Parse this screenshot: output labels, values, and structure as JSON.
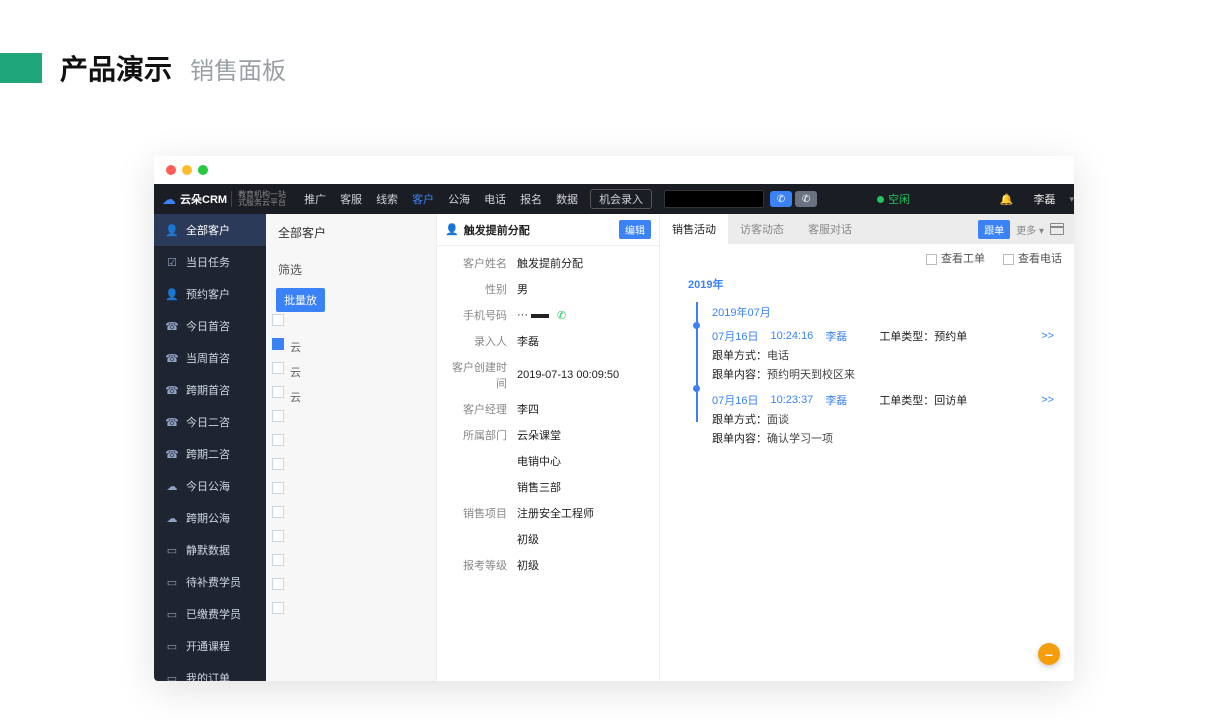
{
  "page": {
    "title": "产品演示",
    "subtitle": "销售面板"
  },
  "topnav": {
    "brand": "云朵CRM",
    "brand_sub1": "教育机构一站",
    "brand_sub2": "式服务云平台",
    "items": [
      "推广",
      "客服",
      "线索",
      "客户",
      "公海",
      "电话",
      "报名",
      "数据"
    ],
    "active_index": 3,
    "opportunity_btn": "机会录入",
    "status_text": "空闲",
    "username": "李磊"
  },
  "sidebar": {
    "items": [
      {
        "icon": "👤",
        "label": "全部客户",
        "active": true
      },
      {
        "icon": "☑",
        "label": "当日任务"
      },
      {
        "icon": "👤",
        "label": "预约客户"
      },
      {
        "icon": "☎",
        "label": "今日首咨"
      },
      {
        "icon": "☎",
        "label": "当周首咨"
      },
      {
        "icon": "☎",
        "label": "跨期首咨"
      },
      {
        "icon": "☎",
        "label": "今日二咨"
      },
      {
        "icon": "☎",
        "label": "跨期二咨"
      },
      {
        "icon": "☁",
        "label": "今日公海"
      },
      {
        "icon": "☁",
        "label": "跨期公海"
      },
      {
        "icon": "▭",
        "label": "静默数据"
      },
      {
        "icon": "▭",
        "label": "待补费学员"
      },
      {
        "icon": "▭",
        "label": "已缴费学员"
      },
      {
        "icon": "▭",
        "label": "开通课程"
      },
      {
        "icon": "▭",
        "label": "我的订单"
      }
    ]
  },
  "list": {
    "header": "全部客户",
    "filter_label": "筛选",
    "batch_btn": "批量放",
    "rows": [
      "云",
      "云",
      "云"
    ]
  },
  "detail": {
    "title": "触发提前分配",
    "edit": "编辑",
    "fields": [
      {
        "label": "客户姓名",
        "value": "触发提前分配"
      },
      {
        "label": "性别",
        "value": "男"
      },
      {
        "label": "手机号码",
        "value": "",
        "phone": true
      },
      {
        "label": "录入人",
        "value": "李磊"
      },
      {
        "label": "客户创建时间",
        "value": "2019-07-13 00:09:50"
      },
      {
        "label": "客户经理",
        "value": "李四"
      },
      {
        "label": "所属部门",
        "value": "云朵课堂"
      },
      {
        "label": "",
        "value": "电销中心"
      },
      {
        "label": "",
        "value": "销售三部"
      },
      {
        "label": "销售项目",
        "value": "注册安全工程师"
      },
      {
        "label": "",
        "value": "初级"
      },
      {
        "label": "报考等级",
        "value": "初级"
      }
    ]
  },
  "right": {
    "tabs": [
      "销售活动",
      "访客动态",
      "客服对话"
    ],
    "active_tab": 0,
    "pill": "跟单",
    "more": "更多 ▾",
    "check1": "查看工单",
    "check2": "查看电话",
    "year": "2019年",
    "month": "2019年07月",
    "entries": [
      {
        "date": "07月16日",
        "time": "10:24:16",
        "user": "李磊",
        "type_label": "工单类型：",
        "type_value": "预约单",
        "method_label": "跟单方式：",
        "method_value": "电话",
        "content_label": "跟单内容：",
        "content_value": "预约明天到校区来",
        "expand": ">>"
      },
      {
        "date": "07月16日",
        "time": "10:23:37",
        "user": "李磊",
        "type_label": "工单类型：",
        "type_value": "回访单",
        "method_label": "跟单方式：",
        "method_value": "面谈",
        "content_label": "跟单内容：",
        "content_value": "确认学习一项",
        "expand": ">>"
      }
    ]
  }
}
